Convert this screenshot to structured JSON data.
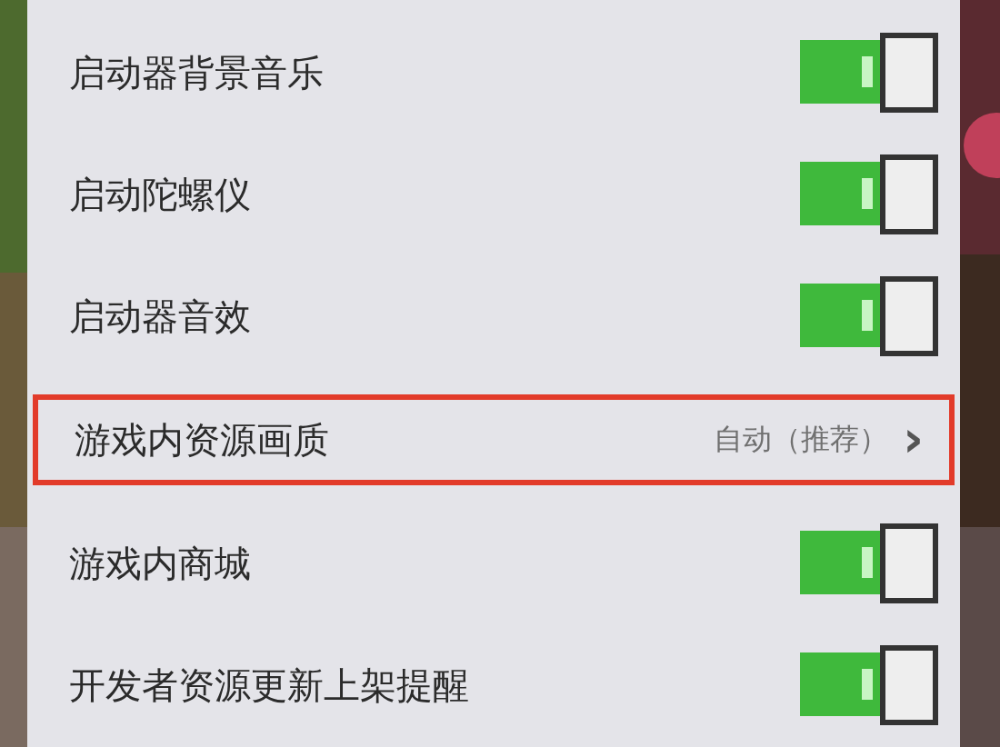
{
  "settings": [
    {
      "kind": "toggle",
      "label": "启动器背景音乐",
      "on": true
    },
    {
      "kind": "toggle",
      "label": "启动陀螺仪",
      "on": true
    },
    {
      "kind": "toggle",
      "label": "启动器音效",
      "on": true
    },
    {
      "kind": "link",
      "label": "游戏内资源画质",
      "value": "自动（推荐）",
      "chevron": "›",
      "highlighted": true
    },
    {
      "kind": "toggle",
      "label": "游戏内商城",
      "on": true
    },
    {
      "kind": "toggle",
      "label": "开发者资源更新上架提醒",
      "on": true
    }
  ]
}
